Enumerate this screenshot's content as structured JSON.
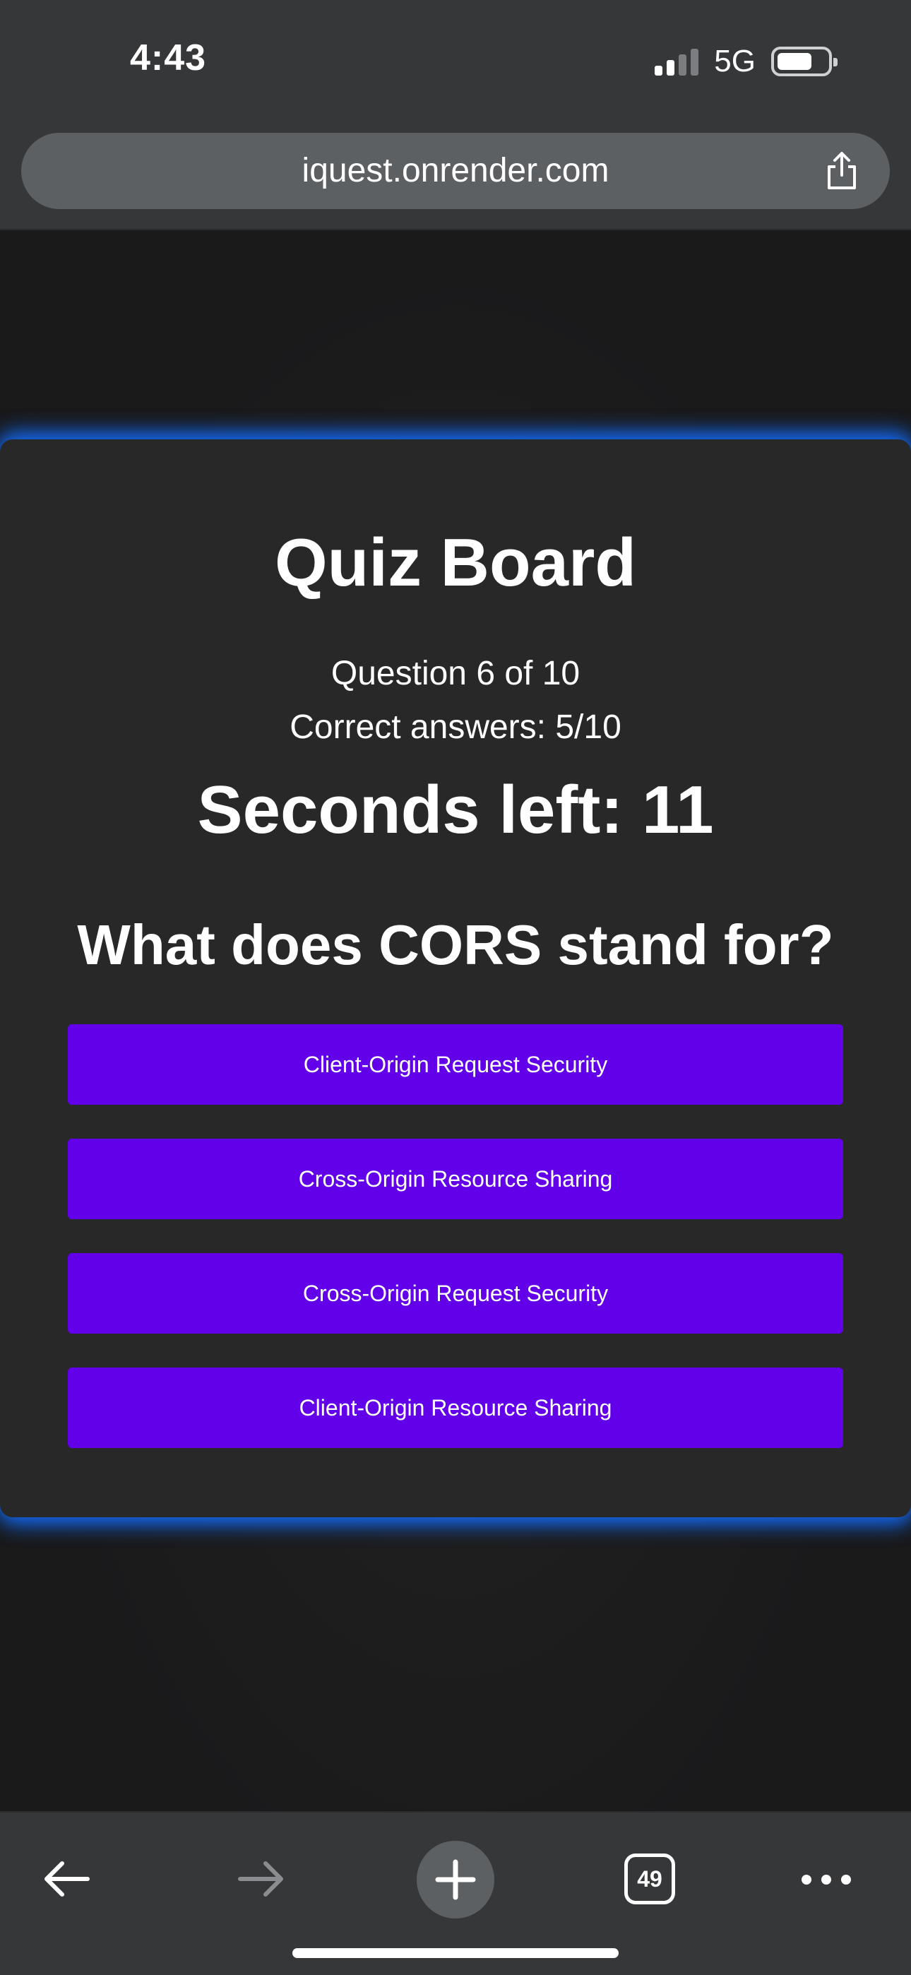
{
  "status_bar": {
    "time": "4:43",
    "network": "5G"
  },
  "browser": {
    "url": "iquest.onrender.com",
    "tab_count": "49"
  },
  "quiz": {
    "title": "Quiz Board",
    "progress": "Question 6 of 10",
    "score": "Correct answers: 5/10",
    "timer": "Seconds left: 11",
    "question": "What does CORS stand for?",
    "answers": [
      "Client-Origin Request Security",
      "Cross-Origin Resource Sharing",
      "Cross-Origin Request Security",
      "Client-Origin Resource Sharing"
    ]
  },
  "colors": {
    "answer_button": "#6200ea",
    "card_glow": "#146eff",
    "card_background": "#282828"
  },
  "icons": [
    "share-icon",
    "back-arrow-icon",
    "forward-arrow-icon",
    "plus-icon",
    "tabs-icon",
    "more-icon"
  ]
}
